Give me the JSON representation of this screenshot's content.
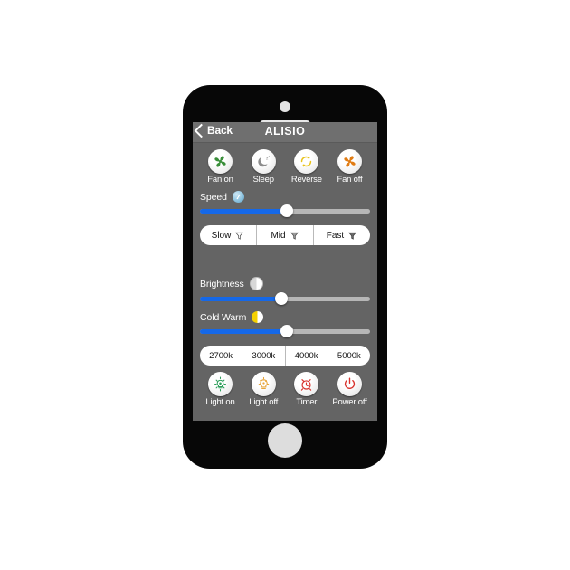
{
  "app": {
    "device": "smartphone-mockup",
    "screen_background": "#646464",
    "accent_blue": "#1568e8"
  },
  "navbar": {
    "back_label": "Back",
    "back_icon": "chevron-left-icon",
    "title": "ALISIO"
  },
  "fan_section": {
    "buttons": [
      {
        "label": "Fan on",
        "icon": "fan-icon",
        "color": "#3a8f3a"
      },
      {
        "label": "Sleep",
        "icon": "moon-sleep-icon",
        "color": "#8d8d8d"
      },
      {
        "label": "Reverse",
        "icon": "reverse-loop-icon",
        "color": "#e8c21a"
      },
      {
        "label": "Fan off",
        "icon": "fan-icon",
        "color": "#e07c14"
      }
    ],
    "speed_slider": {
      "label": "Speed",
      "icon": "speed-fan-icon",
      "value_percent": 51
    },
    "speed_presets": [
      {
        "label": "Slow",
        "icon": "fan-blade-light-icon"
      },
      {
        "label": "Mid",
        "icon": "fan-blade-medium-icon"
      },
      {
        "label": "Fast",
        "icon": "fan-blade-solid-icon"
      }
    ]
  },
  "light_section": {
    "brightness_slider": {
      "label": "Brightness",
      "icon": "half-circle-white-icon",
      "value_percent": 48
    },
    "cold_warm_slider": {
      "label": "Cold Warm",
      "icon": "half-circle-yellow-icon",
      "value_percent": 51
    },
    "color_temperatures": [
      {
        "label": "2700k"
      },
      {
        "label": "3000k"
      },
      {
        "label": "4000k"
      },
      {
        "label": "5000k"
      }
    ],
    "buttons": [
      {
        "label": "Light on",
        "icon": "bulb-on-icon",
        "color": "#2e9e5b"
      },
      {
        "label": "Light off",
        "icon": "bulb-off-icon",
        "color": "#e8a53a"
      },
      {
        "label": "Timer",
        "icon": "alarm-clock-icon",
        "color": "#d8322c"
      },
      {
        "label": "Power off",
        "icon": "power-icon",
        "color": "#d8322c"
      }
    ]
  }
}
